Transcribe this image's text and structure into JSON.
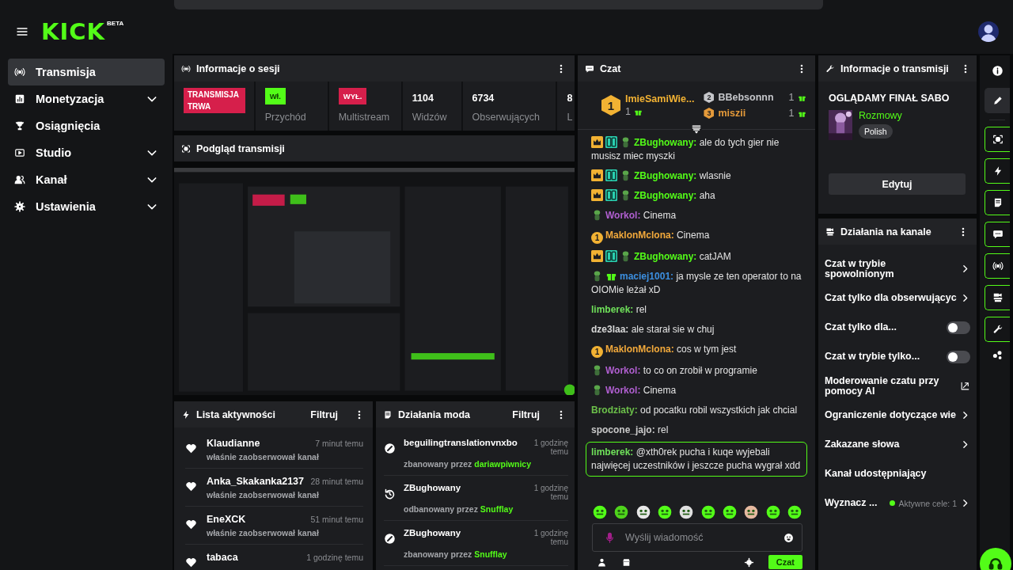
{
  "header": {
    "logo": "KICK",
    "logo_badge": "BETA"
  },
  "sidebar": {
    "items": [
      {
        "label": "Transmisja",
        "selected": true,
        "has_submenu": false
      },
      {
        "label": "Monetyzacja",
        "selected": false,
        "has_submenu": true
      },
      {
        "label": "Osiągnięcia",
        "selected": false,
        "has_submenu": false
      },
      {
        "label": "Studio",
        "selected": false,
        "has_submenu": true
      },
      {
        "label": "Kanał",
        "selected": false,
        "has_submenu": true
      },
      {
        "label": "Ustawienia",
        "selected": false,
        "has_submenu": true
      }
    ]
  },
  "session_info": {
    "title": "Informacje o sesji",
    "stats": [
      {
        "kind": "status",
        "value": "TRANSMISJA TRWA"
      },
      {
        "kind": "toggle",
        "value": "Wł.",
        "on": true,
        "label": "Przychód"
      },
      {
        "kind": "toggle",
        "value": "WYŁ.",
        "on": false,
        "label": "Multistream"
      },
      {
        "kind": "count",
        "value": "1104",
        "label": "Widzów"
      },
      {
        "kind": "count",
        "value": "6734",
        "label": "Obserwujących"
      },
      {
        "kind": "count",
        "value": "8",
        "label": "L"
      }
    ]
  },
  "preview": {
    "title": "Podgląd transmisji",
    "kind": "picture"
  },
  "activity": {
    "title": "Lista aktywności",
    "filter": "Filtruj",
    "items": [
      {
        "user": "Klaudianne",
        "time": "7 minut temu",
        "action": "właśnie zaobserwował kanał"
      },
      {
        "user": "Anka_Skakanka2137",
        "time": "28 minut temu",
        "action": "właśnie zaobserwował kanał"
      },
      {
        "user": "EneXCK",
        "time": "51 minut temu",
        "action": "właśnie zaobserwował kanał"
      },
      {
        "user": "tabaca",
        "time": "1 godzinę temu"
      }
    ]
  },
  "mod_actions": {
    "title": "Działania moda",
    "filter": "Filtruj",
    "items": [
      {
        "kind": "ban",
        "user": "beguilingtranslationvnxbo",
        "time": "1 godzinę temu",
        "action": "zbanowany przez",
        "moderator": "dariawpiwnicy"
      },
      {
        "kind": "unban",
        "user": "ZBughowany",
        "time": "1 godzinę temu",
        "action": "odbanowany przez",
        "moderator": "Snufflay"
      },
      {
        "kind": "ban",
        "user": "ZBughowany",
        "time": "1 godzinę temu",
        "action": "zbanowany przez",
        "moderator": "Snufflay"
      }
    ]
  },
  "chat": {
    "title": "Czat",
    "top_gifters": [
      {
        "rank": "1",
        "name": "ImieSamiWie...",
        "count": "1"
      },
      {
        "rank": "2",
        "name": "BBebsonnn",
        "count": "1"
      },
      {
        "rank": "3",
        "name": "miszii",
        "count": "1"
      }
    ],
    "messages": [
      {
        "badges": [
          {
            "kind": "crown"
          },
          {
            "kind": "og"
          },
          {
            "kind": "pepe"
          }
        ],
        "user": "ZBughowany:",
        "color": "#53fc18",
        "text": "ale do tych gier nie musisz miec myszki",
        "highlighted": false
      },
      {
        "badges": [
          {
            "kind": "crown"
          },
          {
            "kind": "og"
          },
          {
            "kind": "pepe"
          }
        ],
        "user": "ZBughowany:",
        "color": "#53fc18",
        "text": "wlasnie",
        "highlighted": false
      },
      {
        "badges": [
          {
            "kind": "crown"
          },
          {
            "kind": "og"
          },
          {
            "kind": "pepe"
          }
        ],
        "user": "ZBughowany:",
        "color": "#53fc18",
        "text": "aha",
        "highlighted": false
      },
      {
        "badges": [
          {
            "kind": "pepe"
          }
        ],
        "user": "Workol:",
        "color": "#b05fd0",
        "text": "Cinema",
        "highlighted": false
      },
      {
        "badges": [
          {
            "kind": "sub",
            "text": "1"
          }
        ],
        "user": "MaklonMclona:",
        "color": "#f2a93b",
        "text": "Cinema",
        "highlighted": false
      },
      {
        "badges": [
          {
            "kind": "crown"
          },
          {
            "kind": "og"
          },
          {
            "kind": "pepe"
          }
        ],
        "user": "ZBughowany:",
        "color": "#53fc18",
        "text": "catJAM",
        "highlighted": false
      },
      {
        "badges": [
          {
            "kind": "pepe"
          },
          {
            "kind": "gift"
          }
        ],
        "user": "maciej1001:",
        "color": "#3c8fe0",
        "text": "ja mysle ze ten operator to na OIOMie leżał xD",
        "highlighted": false
      },
      {
        "user": "limberek:",
        "color": "#6fe05a",
        "text": "rel",
        "highlighted": false
      },
      {
        "user": "dze3laa:",
        "color": "#d8d8d8",
        "text": "ale starał sie w chuj",
        "highlighted": false
      },
      {
        "badges": [
          {
            "kind": "sub",
            "text": "1"
          }
        ],
        "user": "MaklonMclona:",
        "color": "#f2a93b",
        "text": "cos w tym jest",
        "highlighted": false
      },
      {
        "badges": [
          {
            "kind": "pepe"
          }
        ],
        "user": "Workol:",
        "color": "#b05fd0",
        "text": "to co on zrobił w programie",
        "highlighted": false
      },
      {
        "badges": [
          {
            "kind": "pepe"
          }
        ],
        "user": "Workol:",
        "color": "#b05fd0",
        "text": "Cinema",
        "highlighted": false
      },
      {
        "user": "Brodziaty:",
        "color": "#6cc04a",
        "text": "od pocatku robil wszystkich jak chcial",
        "highlighted": false
      },
      {
        "user": "spocone_jajo:",
        "color": "#c9c9c9",
        "text": "rel",
        "highlighted": false
      },
      {
        "user": "limberek:",
        "color": "#6fe05a",
        "text": "@xth0rek pucha i kuqe wyjebali najwięcej uczestników i jeszcze pucha wygrał xdd",
        "highlighted": true
      }
    ],
    "input": {
      "placeholder": "Wyślij wiadomość"
    },
    "send_button": "Czat"
  },
  "stream_info": {
    "title": "Informacje o transmisji",
    "stream_title": "OGLĄDAMY FINAŁ SABO",
    "category": "Rozmowy",
    "tag": "Polish",
    "edit_button": "Edytuj"
  },
  "channel_actions": {
    "title": "Działania na kanale",
    "items": [
      {
        "kind": "link",
        "label": "Czat w trybie spowolnionym"
      },
      {
        "kind": "link",
        "label": "Czat tylko dla obserwującyc"
      },
      {
        "kind": "toggle",
        "label": "Czat tylko dla...",
        "on": false
      },
      {
        "kind": "toggle",
        "label": "Czat w trybie tylko...",
        "on": false
      },
      {
        "kind": "external",
        "label": "Moderowanie czatu przy pomocy AI"
      },
      {
        "kind": "link",
        "label": "Ograniczenie dotyczące wie"
      },
      {
        "kind": "link",
        "label": "Zakazane słowa"
      },
      {
        "kind": "plain",
        "label": "Kanał udostępniający"
      },
      {
        "kind": "link",
        "label": "Wyznacz ...",
        "status": "Aktywne cele: 1"
      }
    ]
  }
}
